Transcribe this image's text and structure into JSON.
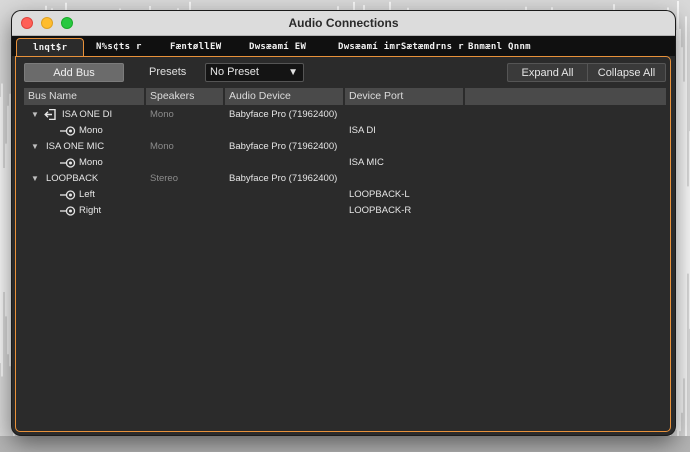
{
  "window": {
    "title": "Audio Connections"
  },
  "tabs": [
    {
      "label": "lnqt$r",
      "active": true
    },
    {
      "label": "N%s¢ts r"
    },
    {
      "label": "FæntøllEW"
    },
    {
      "label": "Dwsæamí EW"
    },
    {
      "label": "Dwsæamí imrSætæmdrns r"
    },
    {
      "label": "Bnmænl Qnnm"
    }
  ],
  "toolbar": {
    "add_bus": "Add Bus",
    "presets_label": "Presets",
    "preset_value": "No Preset",
    "expand_all": "Expand All",
    "collapse_all": "Collapse All"
  },
  "columns": {
    "bus_name": "Bus Name",
    "speakers": "Speakers",
    "audio_device": "Audio Device",
    "device_port": "Device Port"
  },
  "buses": [
    {
      "name": "ISA ONE DI",
      "speakers": "Mono",
      "device": "Babyface Pro (71962400)",
      "icon": "output-icon",
      "channels": [
        {
          "name": "Mono",
          "port": "ISA DI"
        }
      ]
    },
    {
      "name": "ISA ONE MIC",
      "speakers": "Mono",
      "device": "Babyface Pro (71962400)",
      "channels": [
        {
          "name": "Mono",
          "port": "ISA MIC"
        }
      ]
    },
    {
      "name": "LOOPBACK",
      "speakers": "Stereo",
      "device": "Babyface Pro (71962400)",
      "channels": [
        {
          "name": "Left",
          "port": "LOOPBACK-L"
        },
        {
          "name": "Right",
          "port": "LOOPBACK-R"
        }
      ]
    }
  ]
}
